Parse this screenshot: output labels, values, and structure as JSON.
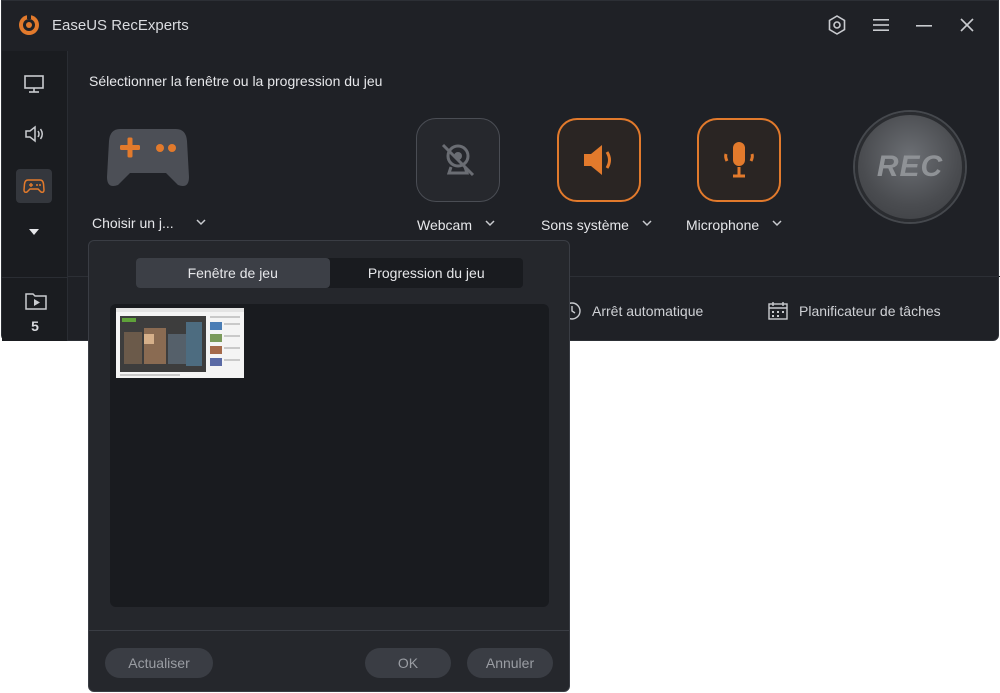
{
  "app": {
    "title": "EaseUS RecExperts"
  },
  "main": {
    "section_title": "Sélectionner la fenêtre ou la progression du jeu",
    "choose_label": "Choisir un j...",
    "webcam_label": "Webcam",
    "system_sound_label": "Sons système",
    "microphone_label": "Microphone",
    "rec_label": "REC",
    "auto_stop_label": "Arrêt automatique",
    "scheduler_label": "Planificateur de tâches"
  },
  "sidebar": {
    "recordings_count": "5"
  },
  "popup": {
    "tabs": [
      "Fenêtre de jeu",
      "Progression du jeu"
    ],
    "refresh_label": "Actualiser",
    "ok_label": "OK",
    "cancel_label": "Annuler"
  },
  "colors": {
    "accent": "#e27a2c",
    "bg": "#1f2126"
  }
}
